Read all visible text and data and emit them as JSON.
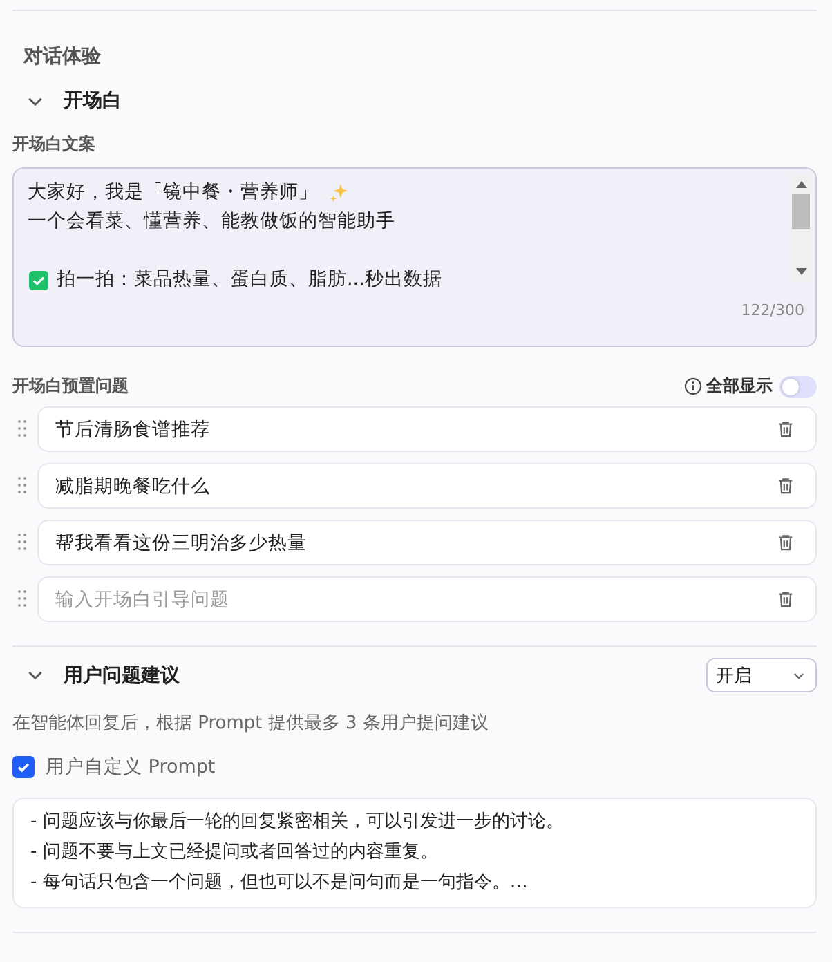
{
  "section_title": "对话体验",
  "opening": {
    "title": "开场白",
    "expanded": true,
    "text_label": "开场白文案",
    "text_lines": [
      {
        "kind": "sparkle",
        "text": "大家好，我是「镜中餐・营养师」"
      },
      {
        "kind": "text",
        "text": "一个会看菜、懂营养、能教做饭的智能助手"
      },
      {
        "kind": "blank"
      },
      {
        "kind": "check",
        "text": "拍一拍：菜品热量、蛋白质、脂肪...秒出数据"
      }
    ],
    "counter": "122/300",
    "questions_label": "开场白预置问题",
    "show_all": {
      "label": "全部显示",
      "on": false
    },
    "questions": [
      {
        "value": "节后清肠食谱推荐"
      },
      {
        "value": "减脂期晚餐吃什么"
      },
      {
        "value": "帮我看看这份三明治多少热量"
      },
      {
        "placeholder": "输入开场白引导问题"
      }
    ]
  },
  "suggestions": {
    "title": "用户问题建议",
    "expanded": true,
    "select": "开启",
    "description": "在智能体回复后，根据 Prompt 提供最多 3 条用户提问建议",
    "custom_prompt": {
      "label": "用户自定义 Prompt",
      "checked": true
    },
    "prompt_lines": [
      "- 问题应该与你最后一轮的回复紧密相关，可以引发进一步的讨论。",
      "- 问题不要与上文已经提问或者回答过的内容重复。",
      "- 每句话只包含一个问题，但也可以不是问句而是一句指令。…"
    ]
  }
}
